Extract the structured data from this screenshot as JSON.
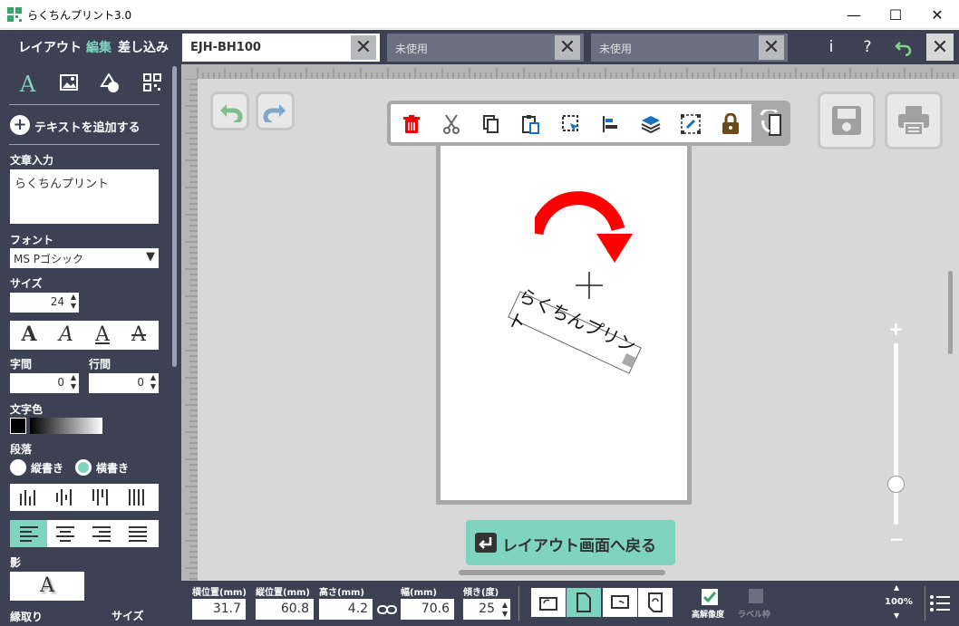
{
  "app": {
    "title": "らくちんプリント3.0"
  },
  "window": {
    "minimize": "—",
    "maximize": "☐",
    "close": "✕"
  },
  "modes": {
    "layout": "レイアウト",
    "edit": "編集",
    "merge": "差し込み"
  },
  "tabs": [
    {
      "label": "EJH-BH100",
      "active": true
    },
    {
      "label": "未使用",
      "active": false
    },
    {
      "label": "未使用",
      "active": false
    }
  ],
  "topicons": {
    "info": "i",
    "help": "?"
  },
  "sidebar": {
    "add_text": "テキストを追加する",
    "text_input_label": "文章入力",
    "text_value": "らくちんプリント",
    "font_label": "フォント",
    "font_value": "MS Pゴシック",
    "size_label": "サイズ",
    "size_value": "24",
    "char_spacing_label": "字間",
    "char_spacing_value": "0",
    "line_spacing_label": "行間",
    "line_spacing_value": "0",
    "color_label": "文字色",
    "paragraph_label": "段落",
    "vertical_label": "縦書き",
    "horizontal_label": "横書き",
    "shadow_label": "影",
    "outline_label": "縁取り",
    "outline_size_label": "サイズ"
  },
  "canvas": {
    "label_text": "らくちんプリント",
    "back_button": "レイアウト画面へ戻る"
  },
  "bottom": {
    "x_label": "横位置(mm)",
    "x_value": "31.7",
    "y_label": "縦位置(mm)",
    "y_value": "60.8",
    "h_label": "高さ(mm)",
    "h_value": "4.2",
    "w_label": "幅(mm)",
    "w_value": "70.6",
    "angle_label": "傾き(度)",
    "angle_value": "25",
    "hires_label": "高解像度",
    "labelframe_label": "ラベル枠",
    "zoom": "100%"
  },
  "colors": {
    "accent": "#7fd4c0",
    "dark": "#3c4253",
    "red": "#e00000"
  }
}
